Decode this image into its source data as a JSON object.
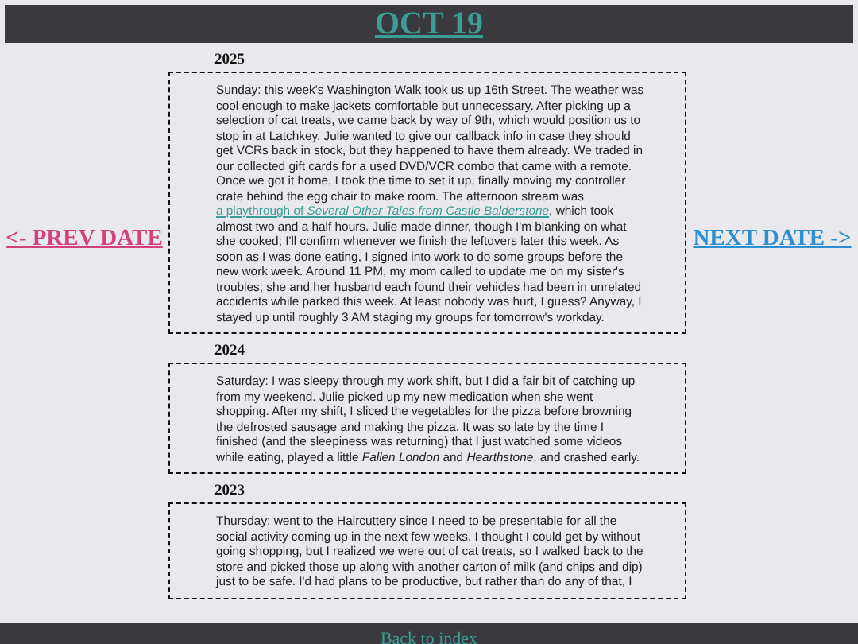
{
  "header": {
    "title": "OCT 19"
  },
  "prev_link": {
    "label": "<- PREV DATE"
  },
  "next_link": {
    "label": "NEXT DATE ->"
  },
  "entries": [
    {
      "year": "2025",
      "parts": [
        {
          "kind": "text",
          "text": "Sunday: this week's Washington Walk took us up 16th Street. The weather was cool enough to make jackets comfortable but unnecessary. After picking up a selection of cat treats, we came back by way of 9th, which would position us to stop in at Latchkey. Julie wanted to give our callback info in case they should get VCRs back in stock, but they happened to have them already. We traded in our collected gift cards for a used DVD/VCR combo that came with a remote. Once we got it home, I took the time to set it up, finally moving my controller crate behind the egg chair to make room. The afternoon stream was "
        },
        {
          "kind": "link",
          "text": "a playthrough of *Several Other Tales from Castle Balderstone*"
        },
        {
          "kind": "text",
          "text": ", which took almost two and a half hours. Julie made dinner, though I'm blanking on what she cooked; I'll confirm whenever we finish the leftovers later this week. As soon as I was done eating, I signed into work to do some groups before the new work week. Around 11 PM, my mom called to update me on my sister's troubles; she and her husband each found their vehicles had been in unrelated accidents while parked this week. At least nobody was hurt, I guess? Anyway, I stayed up until roughly 3 AM staging my groups for tomorrow's workday."
        }
      ]
    },
    {
      "year": "2024",
      "parts": [
        {
          "kind": "text",
          "text": "Saturday: I was sleepy through my work shift, but I did a fair bit of catching up from my weekend. Julie picked up my new medication when she went shopping. After my shift, I sliced the vegetables for the pizza before browning the defrosted sausage and making the pizza. It was so late by the time I finished (and the sleepiness was returning) that I just watched some videos while eating, played a little *Fallen London* and *Hearthstone*, and crashed early."
        }
      ]
    },
    {
      "year": "2023",
      "parts": [
        {
          "kind": "text",
          "text": "Thursday: went to the Haircuttery since I need to be presentable for all the social activity coming up in the next few weeks. I thought I could get by without going shopping, but I realized we were out of cat treats, so I walked back to the store and picked those up along with another carton of milk (and chips and dip) just to be safe. I'd had plans to be productive, but rather than do any of that, I"
        }
      ]
    }
  ],
  "footer": {
    "link": "Back to index"
  }
}
